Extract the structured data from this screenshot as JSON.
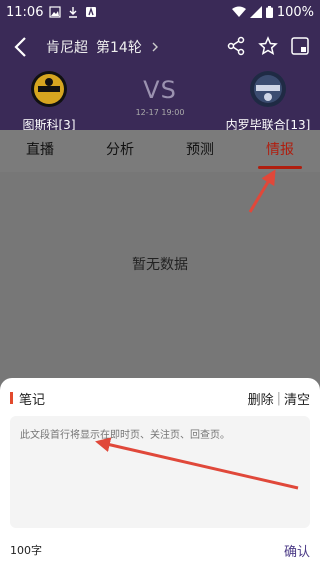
{
  "status_bar": {
    "time": "11:06",
    "battery": "100%"
  },
  "header": {
    "league": "肯尼超",
    "round": "第14轮",
    "home_team": "图斯科[3]",
    "away_team": "内罗毕联合[13]",
    "vs": "VS",
    "match_time": "12-17 19:00"
  },
  "tabs": [
    {
      "label": "直播"
    },
    {
      "label": "分析"
    },
    {
      "label": "预测"
    },
    {
      "label": "情报"
    }
  ],
  "content": {
    "empty_text": "暂无数据"
  },
  "note": {
    "title": "笔记",
    "delete_label": "删除",
    "clear_label": "清空",
    "placeholder": "此文段首行将显示在即时页、关注页、回查页。",
    "char_count": "100字",
    "confirm_label": "确认"
  },
  "colors": {
    "header_bg": "#3a2a57",
    "accent_red": "#b01e0f",
    "confirm": "#4b3a86"
  }
}
